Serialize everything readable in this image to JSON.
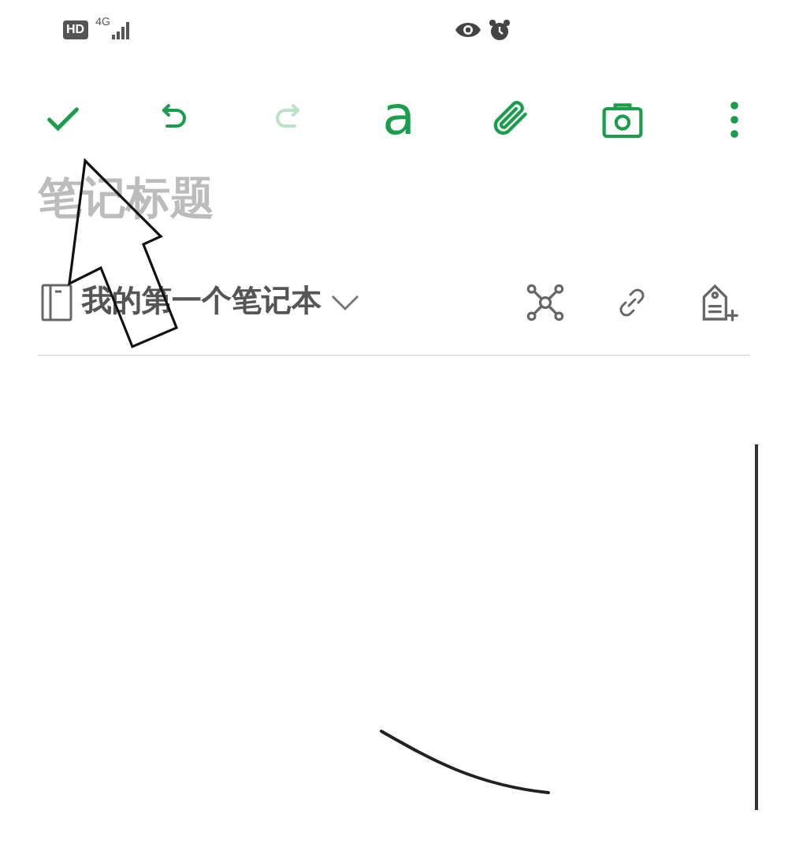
{
  "status_bar": {
    "badge": "HD",
    "network": "4G"
  },
  "toolbar": [
    {
      "kind": "done",
      "disabled": false
    },
    {
      "kind": "undo",
      "disabled": false
    },
    {
      "kind": "redo",
      "disabled": true
    },
    {
      "kind": "format",
      "label": "a",
      "disabled": false
    },
    {
      "kind": "attach",
      "disabled": false
    },
    {
      "kind": "camera",
      "disabled": false
    },
    {
      "kind": "more",
      "disabled": false
    }
  ],
  "title": {
    "placeholder": "笔记标题"
  },
  "notebook": {
    "name": "我的第一个笔记本"
  },
  "note_actions": [
    {
      "kind": "mindmap"
    },
    {
      "kind": "link"
    },
    {
      "kind": "tag"
    }
  ]
}
